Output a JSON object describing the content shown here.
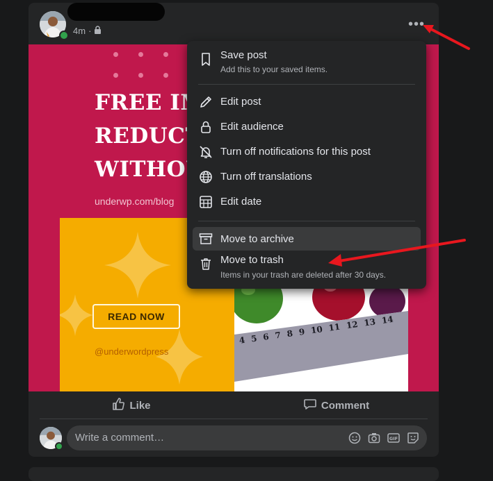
{
  "post": {
    "time": "4m",
    "separator": "·",
    "more_label": "•••"
  },
  "image": {
    "headline": "FREE IM\nREDUCT\nWITHOU",
    "url": "underwp.com/blog",
    "read_now": "READ NOW",
    "handle": "@underwordpress",
    "ruler_numbers": [
      "4",
      "5",
      "6",
      "7",
      "8",
      "9",
      "10",
      "11",
      "12",
      "13",
      "14"
    ]
  },
  "actions": {
    "like": "Like",
    "comment": "Comment"
  },
  "comment_box": {
    "placeholder": "Write a comment…"
  },
  "menu": {
    "items": [
      {
        "label": "Save post",
        "sub": "Add this to your saved items.",
        "icon": "bookmark-icon"
      },
      {
        "label": "Edit post",
        "icon": "pencil-icon"
      },
      {
        "label": "Edit audience",
        "icon": "lock-icon"
      },
      {
        "label": "Turn off notifications for this post",
        "icon": "bell-off-icon"
      },
      {
        "label": "Turn off translations",
        "icon": "globe-icon"
      },
      {
        "label": "Edit date",
        "icon": "calendar-icon"
      },
      {
        "label": "Move to archive",
        "icon": "archive-icon"
      },
      {
        "label": "Move to trash",
        "sub": "Items in your trash are deleted after 30 days.",
        "icon": "trash-icon"
      }
    ]
  },
  "colors": {
    "background": "#18191a",
    "card": "#242526",
    "image_bg": "#c0184c",
    "yellow": "#f5ac00",
    "arrow": "#e8171e",
    "online": "#31a24c"
  }
}
